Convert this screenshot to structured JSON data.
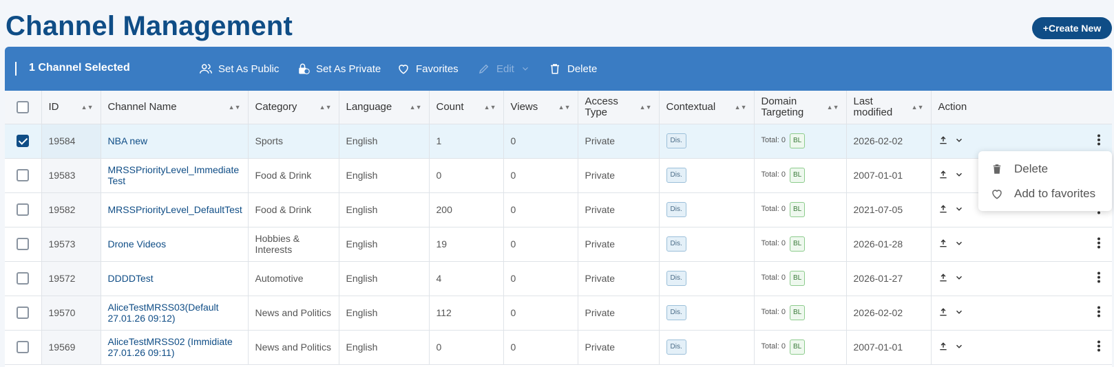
{
  "page": {
    "title": "Channel Management",
    "create_label": "+Create New"
  },
  "actionbar": {
    "selected_label": "1 Channel Selected",
    "items": {
      "set_public": "Set As Public",
      "set_private": "Set As Private",
      "favorites": "Favorites",
      "edit": "Edit",
      "delete": "Delete"
    }
  },
  "table": {
    "columns": [
      "ID",
      "Channel Name",
      "Category",
      "Language",
      "Count",
      "Views",
      "Access Type",
      "Contextual",
      "Domain Targeting",
      "Last modified",
      "Action"
    ],
    "rows": [
      {
        "id": "19584",
        "name": "NBA new",
        "category": "Sports",
        "language": "English",
        "count": "1",
        "views": "0",
        "access": "Private",
        "contextual": "Dis.",
        "total": "Total: 0",
        "domain_tag": "BL",
        "modified": "2026-02-02",
        "selected": true
      },
      {
        "id": "19583",
        "name": "MRSSPriorityLevel_Immediate Test",
        "category": "Food & Drink",
        "language": "English",
        "count": "0",
        "views": "0",
        "access": "Private",
        "contextual": "Dis.",
        "total": "Total: 0",
        "domain_tag": "BL",
        "modified": "2007-01-01",
        "selected": false
      },
      {
        "id": "19582",
        "name": "MRSSPriorityLevel_DefaultTest",
        "category": "Food & Drink",
        "language": "English",
        "count": "200",
        "views": "0",
        "access": "Private",
        "contextual": "Dis.",
        "total": "Total: 0",
        "domain_tag": "BL",
        "modified": "2021-07-05",
        "selected": false
      },
      {
        "id": "19573",
        "name": "Drone Videos",
        "category": "Hobbies & Interests",
        "language": "English",
        "count": "19",
        "views": "0",
        "access": "Private",
        "contextual": "Dis.",
        "total": "Total: 0",
        "domain_tag": "BL",
        "modified": "2026-01-28",
        "selected": false
      },
      {
        "id": "19572",
        "name": "DDDDTest",
        "category": "Automotive",
        "language": "English",
        "count": "4",
        "views": "0",
        "access": "Private",
        "contextual": "Dis.",
        "total": "Total: 0",
        "domain_tag": "BL",
        "modified": "2026-01-27",
        "selected": false
      },
      {
        "id": "19570",
        "name": "AliceTestMRSS03(Default 27.01.26 09:12)",
        "category": "News and Politics",
        "language": "English",
        "count": "112",
        "views": "0",
        "access": "Private",
        "contextual": "Dis.",
        "total": "Total: 0",
        "domain_tag": "BL",
        "modified": "2026-02-02",
        "selected": false
      },
      {
        "id": "19569",
        "name": "AliceTestMRSS02 (Immidiate 27.01.26 09:11)",
        "category": "News and Politics",
        "language": "English",
        "count": "0",
        "views": "0",
        "access": "Private",
        "contextual": "Dis.",
        "total": "Total: 0",
        "domain_tag": "BL",
        "modified": "2007-01-01",
        "selected": false
      }
    ]
  },
  "row_menu": {
    "delete": "Delete",
    "add_favorites": "Add to favorites"
  },
  "colors": {
    "brand": "#0f4d86",
    "actionbar": "#3a7cc3"
  }
}
